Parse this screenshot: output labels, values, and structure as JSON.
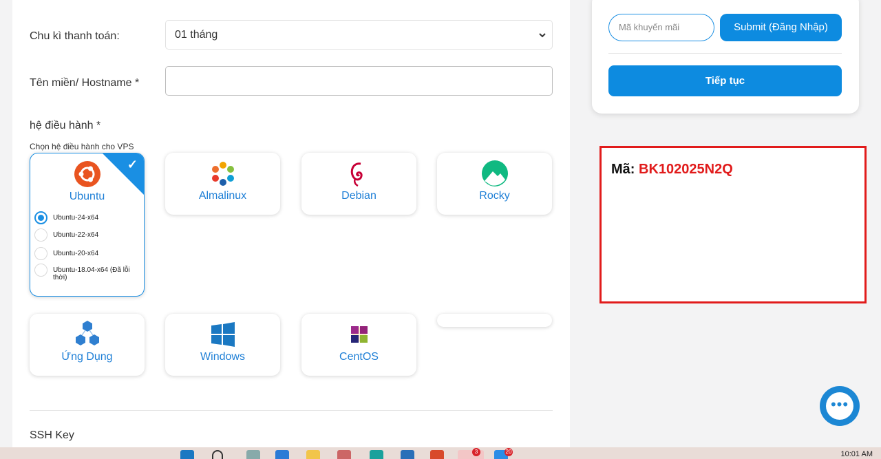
{
  "form": {
    "billing_label": "Chu kì thanh toán:",
    "billing_value": "01 tháng",
    "hostname_label": "Tên miền/ Hostname *",
    "os_label": "hệ điều hành *",
    "os_hint": "Chọn hệ điều hành cho VPS",
    "ssh_label": "SSH Key"
  },
  "os_options": [
    {
      "name": "Ubuntu",
      "icon": "ubuntu-logo-icon",
      "selected": true
    },
    {
      "name": "Almalinux",
      "icon": "almalinux-logo-icon"
    },
    {
      "name": "Debian",
      "icon": "debian-logo-icon"
    },
    {
      "name": "Rocky",
      "icon": "rocky-logo-icon"
    },
    {
      "name": "Ứng Dụng",
      "icon": "apps-cubes-icon"
    },
    {
      "name": "Windows",
      "icon": "windows-logo-icon"
    },
    {
      "name": "CentOS",
      "icon": "centos-logo-icon"
    }
  ],
  "ubuntu_versions": [
    {
      "label": "Ubuntu-24-x64",
      "checked": true
    },
    {
      "label": "Ubuntu-22-x64",
      "checked": false
    },
    {
      "label": "Ubuntu-20-x64",
      "checked": false
    },
    {
      "label": "Ubuntu-18.04-x64 (Đã lỗi thời)",
      "checked": false
    }
  ],
  "sidebar": {
    "promo_placeholder": "Mã khuyến mãi",
    "submit_label": "Submit (Đăng Nhập)",
    "continue_label": "Tiếp tục"
  },
  "code_box": {
    "label": "Mã:",
    "value": "BK102025N2Q"
  },
  "taskbar": {
    "time": "10:01 AM",
    "badges": [
      "3",
      "20"
    ]
  },
  "colors": {
    "accent": "#1a8fe3",
    "button": "#0d8be0",
    "highlight_red": "#e11b1b"
  }
}
